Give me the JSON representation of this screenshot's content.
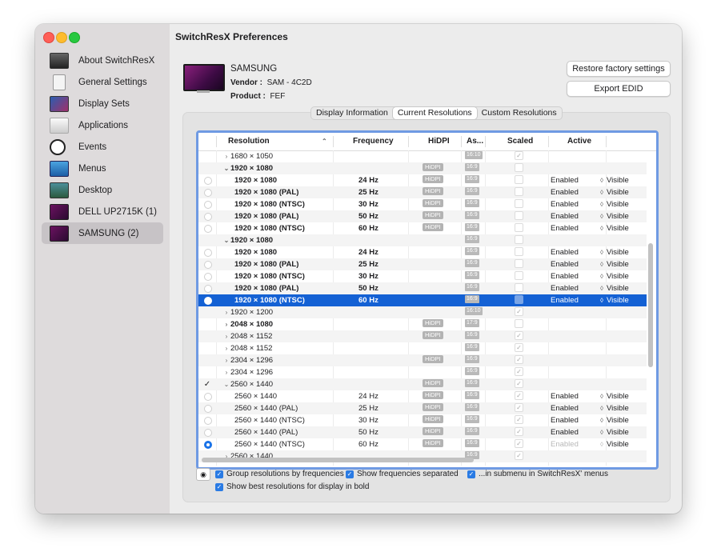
{
  "window": {
    "title": "SwitchResX Preferences"
  },
  "sidebar": {
    "items": [
      {
        "label": "About SwitchResX",
        "icon": "about-icon"
      },
      {
        "label": "General Settings",
        "icon": "general-settings-icon"
      },
      {
        "label": "Display Sets",
        "icon": "display-sets-icon"
      },
      {
        "label": "Applications",
        "icon": "applications-icon"
      },
      {
        "label": "Events",
        "icon": "clock-icon"
      },
      {
        "label": "Menus",
        "icon": "menus-icon"
      },
      {
        "label": "Desktop",
        "icon": "desktop-icon"
      },
      {
        "label": "DELL UP2715K (1)",
        "icon": "monitor-icon"
      },
      {
        "label": "SAMSUNG (2)",
        "icon": "monitor-icon",
        "selected": true
      }
    ]
  },
  "display": {
    "name": "SAMSUNG",
    "vendor_label": "Vendor :",
    "vendor_value": "SAM - 4C2D",
    "product_label": "Product :",
    "product_value": "FEF"
  },
  "buttons": {
    "restore": "Restore factory settings",
    "export": "Export EDID"
  },
  "tabs": [
    {
      "label": "Display Information",
      "active": false
    },
    {
      "label": "Current Resolutions",
      "active": true
    },
    {
      "label": "Custom Resolutions",
      "active": false
    }
  ],
  "table": {
    "headers": {
      "resolution": "Resolution",
      "frequency": "Frequency",
      "hidpi": "HiDPI",
      "aspect": "As...",
      "scaled": "Scaled",
      "active": "Active"
    },
    "rows": [
      {
        "kind": "group",
        "disclosure": "›",
        "res": "1680 × 1050",
        "bold": false,
        "freq": "",
        "hidpi": "",
        "aspect": "16:10",
        "scaled": "✓",
        "active": "",
        "visible": "",
        "radio": "",
        "check": ""
      },
      {
        "kind": "group",
        "disclosure": "⌄",
        "res": "1920 × 1080",
        "bold": true,
        "freq": "",
        "hidpi": "HiDPI",
        "aspect": "16:9",
        "scaled": "",
        "active": "",
        "visible": "",
        "radio": "",
        "check": ""
      },
      {
        "kind": "sub",
        "res": "1920 × 1080",
        "bold": true,
        "freq": "24 Hz",
        "hidpi": "HiDPI",
        "aspect": "16:9",
        "scaled": "",
        "active": "Enabled",
        "visible": "Visible",
        "radio": "off",
        "check": ""
      },
      {
        "kind": "sub",
        "res": "1920 × 1080 (PAL)",
        "bold": true,
        "freq": "25 Hz",
        "hidpi": "HiDPI",
        "aspect": "16:9",
        "scaled": "",
        "active": "Enabled",
        "visible": "Visible",
        "radio": "off",
        "check": ""
      },
      {
        "kind": "sub",
        "res": "1920 × 1080 (NTSC)",
        "bold": true,
        "freq": "30 Hz",
        "hidpi": "HiDPI",
        "aspect": "16:9",
        "scaled": "",
        "active": "Enabled",
        "visible": "Visible",
        "radio": "off",
        "check": ""
      },
      {
        "kind": "sub",
        "res": "1920 × 1080 (PAL)",
        "bold": true,
        "freq": "50 Hz",
        "hidpi": "HiDPI",
        "aspect": "16:9",
        "scaled": "",
        "active": "Enabled",
        "visible": "Visible",
        "radio": "off",
        "check": ""
      },
      {
        "kind": "sub",
        "res": "1920 × 1080 (NTSC)",
        "bold": true,
        "freq": "60 Hz",
        "hidpi": "HiDPI",
        "aspect": "16:9",
        "scaled": "",
        "active": "Enabled",
        "visible": "Visible",
        "radio": "off",
        "check": ""
      },
      {
        "kind": "group",
        "disclosure": "⌄",
        "res": "1920 × 1080",
        "bold": true,
        "freq": "",
        "hidpi": "",
        "aspect": "16:9",
        "scaled": "",
        "active": "",
        "visible": "",
        "radio": "",
        "check": ""
      },
      {
        "kind": "sub",
        "res": "1920 × 1080",
        "bold": true,
        "freq": "24 Hz",
        "hidpi": "",
        "aspect": "16:9",
        "scaled": "",
        "active": "Enabled",
        "visible": "Visible",
        "radio": "off",
        "check": ""
      },
      {
        "kind": "sub",
        "res": "1920 × 1080 (PAL)",
        "bold": true,
        "freq": "25 Hz",
        "hidpi": "",
        "aspect": "16:9",
        "scaled": "",
        "active": "Enabled",
        "visible": "Visible",
        "radio": "off",
        "check": ""
      },
      {
        "kind": "sub",
        "res": "1920 × 1080 (NTSC)",
        "bold": true,
        "freq": "30 Hz",
        "hidpi": "",
        "aspect": "16:9",
        "scaled": "",
        "active": "Enabled",
        "visible": "Visible",
        "radio": "off",
        "check": ""
      },
      {
        "kind": "sub",
        "res": "1920 × 1080 (PAL)",
        "bold": true,
        "freq": "50 Hz",
        "hidpi": "",
        "aspect": "16:9",
        "scaled": "",
        "active": "Enabled",
        "visible": "Visible",
        "radio": "off",
        "check": ""
      },
      {
        "kind": "sub",
        "res": "1920 × 1080 (NTSC)",
        "bold": true,
        "freq": "60 Hz",
        "hidpi": "",
        "aspect": "16:9",
        "scaled": "box",
        "active": "Enabled",
        "visible": "Visible",
        "radio": "white",
        "check": "",
        "selected": true
      },
      {
        "kind": "group",
        "disclosure": "›",
        "res": "1920 × 1200",
        "bold": false,
        "freq": "",
        "hidpi": "",
        "aspect": "16:10",
        "scaled": "✓",
        "active": "",
        "visible": "",
        "radio": "",
        "check": ""
      },
      {
        "kind": "group",
        "disclosure": "›",
        "res": "2048 × 1080",
        "bold": true,
        "freq": "",
        "hidpi": "HiDPI",
        "aspect": "17:9",
        "scaled": "",
        "active": "",
        "visible": "",
        "radio": "",
        "check": ""
      },
      {
        "kind": "group",
        "disclosure": "›",
        "res": "2048 × 1152",
        "bold": false,
        "freq": "",
        "hidpi": "HiDPI",
        "aspect": "16:9",
        "scaled": "✓",
        "active": "",
        "visible": "",
        "radio": "",
        "check": ""
      },
      {
        "kind": "group",
        "disclosure": "›",
        "res": "2048 × 1152",
        "bold": false,
        "freq": "",
        "hidpi": "",
        "aspect": "16:9",
        "scaled": "✓",
        "active": "",
        "visible": "",
        "radio": "",
        "check": ""
      },
      {
        "kind": "group",
        "disclosure": "›",
        "res": "2304 × 1296",
        "bold": false,
        "freq": "",
        "hidpi": "HiDPI",
        "aspect": "16:9",
        "scaled": "✓",
        "active": "",
        "visible": "",
        "radio": "",
        "check": ""
      },
      {
        "kind": "group",
        "disclosure": "›",
        "res": "2304 × 1296",
        "bold": false,
        "freq": "",
        "hidpi": "",
        "aspect": "16:9",
        "scaled": "✓",
        "active": "",
        "visible": "",
        "radio": "",
        "check": ""
      },
      {
        "kind": "group",
        "disclosure": "⌄",
        "res": "2560 × 1440",
        "bold": false,
        "freq": "",
        "hidpi": "HiDPI",
        "aspect": "16:9",
        "scaled": "✓",
        "active": "",
        "visible": "",
        "radio": "",
        "check": "✓"
      },
      {
        "kind": "sub",
        "res": "2560 × 1440",
        "bold": false,
        "freq": "24 Hz",
        "hidpi": "HiDPI",
        "aspect": "16:9",
        "scaled": "✓",
        "active": "Enabled",
        "visible": "Visible",
        "radio": "off",
        "check": ""
      },
      {
        "kind": "sub",
        "res": "2560 × 1440 (PAL)",
        "bold": false,
        "freq": "25 Hz",
        "hidpi": "HiDPI",
        "aspect": "16:9",
        "scaled": "✓",
        "active": "Enabled",
        "visible": "Visible",
        "radio": "off",
        "check": ""
      },
      {
        "kind": "sub",
        "res": "2560 × 1440 (NTSC)",
        "bold": false,
        "freq": "30 Hz",
        "hidpi": "HiDPI",
        "aspect": "16:9",
        "scaled": "✓",
        "active": "Enabled",
        "visible": "Visible",
        "radio": "off",
        "check": ""
      },
      {
        "kind": "sub",
        "res": "2560 × 1440 (PAL)",
        "bold": false,
        "freq": "50 Hz",
        "hidpi": "HiDPI",
        "aspect": "16:9",
        "scaled": "✓",
        "active": "Enabled",
        "visible": "Visible",
        "radio": "off",
        "check": ""
      },
      {
        "kind": "sub",
        "res": "2560 × 1440 (NTSC)",
        "bold": false,
        "freq": "60 Hz",
        "hidpi": "HiDPI",
        "aspect": "16:9",
        "scaled": "✓",
        "active": "Enabled",
        "visible": "Visible",
        "radio": "on",
        "check": "",
        "active_dim": true
      },
      {
        "kind": "group",
        "disclosure": "›",
        "res": "2560 × 1440",
        "bold": false,
        "freq": "",
        "hidpi": "",
        "aspect": "16:9",
        "scaled": "✓",
        "active": "",
        "visible": "",
        "radio": "",
        "check": ""
      }
    ]
  },
  "footer": {
    "eye_icon": "eye-icon",
    "opt1": "Group resolutions by frequencies",
    "opt2": "Show frequencies separated",
    "opt3": "...in submenu in SwitchResX' menus",
    "opt4": "Show best resolutions for display in bold"
  }
}
